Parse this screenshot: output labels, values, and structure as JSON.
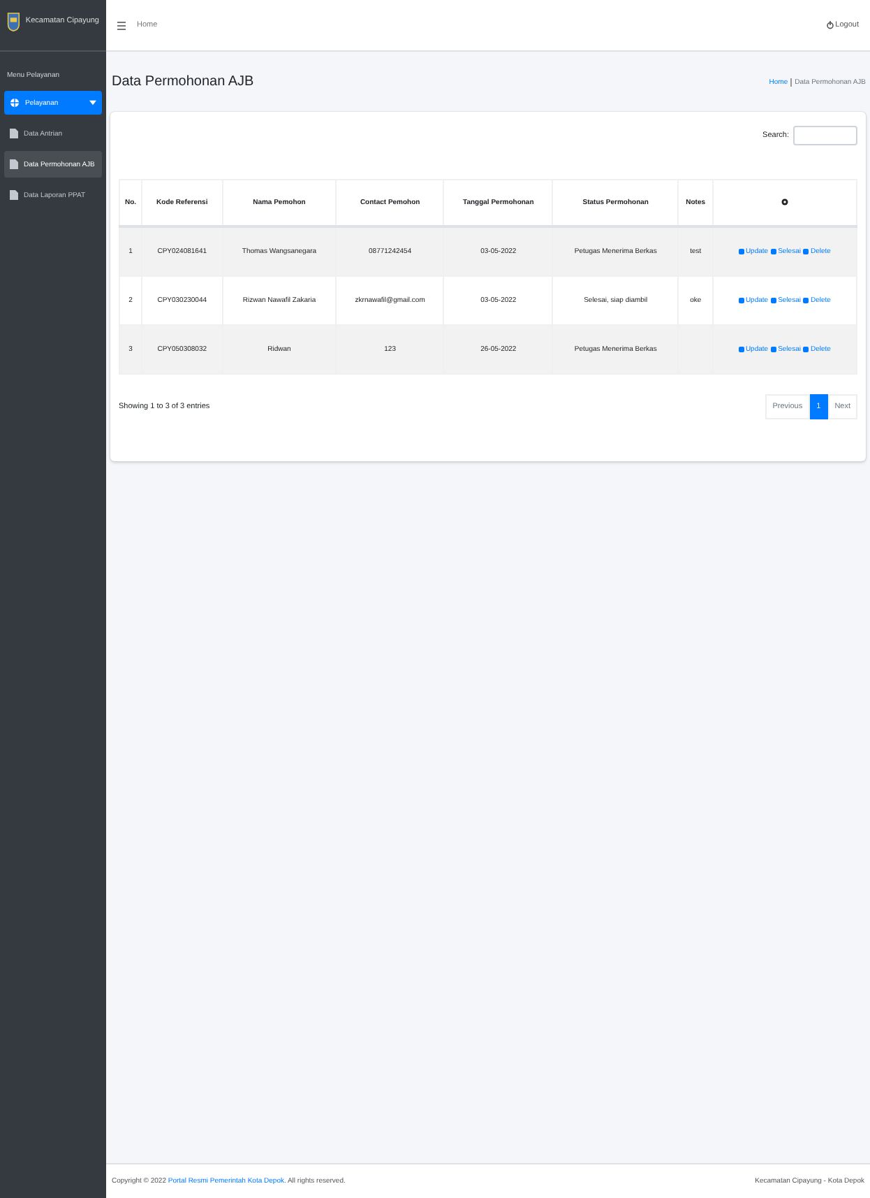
{
  "brand": {
    "title": "Kecamatan Cipayung"
  },
  "sidebar": {
    "section": "Menu Pelayanan",
    "items": [
      {
        "label": "Pelayanan",
        "selected": true,
        "expanded": true,
        "children": [
          {
            "label": "Data Antrian",
            "selected": false
          },
          {
            "label": "Data Permohonan AJB",
            "selected": true
          },
          {
            "label": "Data Laporan PPAT",
            "selected": false
          }
        ]
      }
    ]
  },
  "topbar": {
    "home": "Home",
    "logout": "Logout"
  },
  "page": {
    "title": "Data Permohonan AJB",
    "breadcrumb": [
      "Home",
      "Data Permohonan AJB"
    ]
  },
  "search": {
    "label": "Search:"
  },
  "table": {
    "columns": [
      "No.",
      "Kode Referensi",
      "Nama Pemohon",
      "Contact Pemohon",
      "Tanggal Permohonan",
      "Status Permohonan",
      "Notes"
    ],
    "rows": [
      {
        "no": "1",
        "kode": "CPY024081641",
        "nama": "Thomas Wangsanegara",
        "contact": "08771242454",
        "tanggal": "03-05-2022",
        "status": "Petugas Menerima Berkas",
        "notes": "test",
        "actions": [
          "Update",
          "Selesai",
          "Delete"
        ]
      },
      {
        "no": "2",
        "kode": "CPY030230044",
        "nama": "Rizwan Nawafil Zakaria",
        "contact": "zkrnawafil@gmail.com",
        "tanggal": "03-05-2022",
        "status": "Selesai, siap diambil",
        "notes": "oke",
        "actions": [
          "Update",
          "Selesai",
          "Delete"
        ]
      },
      {
        "no": "3",
        "kode": "CPY050308032",
        "nama": "Ridwan",
        "contact": "123",
        "tanggal": "26-05-2022",
        "status": "Petugas Menerima Berkas",
        "actions": [
          "Update",
          "Selesai",
          "Delete"
        ]
      }
    ]
  },
  "info": "Showing 1 to 3 of 3 entries",
  "pagination": [
    {
      "label": "Previous",
      "selected": false
    },
    {
      "label": "1",
      "selected": true
    },
    {
      "label": "Next",
      "selected": false
    }
  ],
  "footer": {
    "prefix": "Copyright © 2022 ",
    "link": "Portal Resmi Pemerintah Kota Depok.",
    "suffix": " All rights reserved.",
    "right": "Kecamatan Cipayung - Kota Depok"
  }
}
